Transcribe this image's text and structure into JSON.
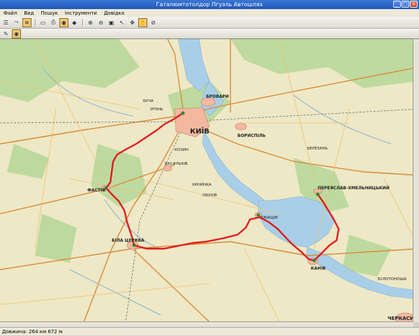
{
  "window": {
    "title": "Гаталюмтотолдор Пгуэль Автошлях"
  },
  "menu": {
    "items": [
      "Файл",
      "Вид",
      "Пошук",
      "Інструменти",
      "Довідка"
    ]
  },
  "map": {
    "cities": {
      "kyiv": "КИЇВ",
      "brovary": "БРОВАРИ",
      "boryspil": "БОРИСПІЛЬ",
      "fastiv": "ФАСТІВ",
      "bila_tserkva": "БІЛА ЦЕРКВА",
      "pereiaslav": "ПЕРЕЯСЛАВ-ХМЕЛЬНИЦЬКИЙ",
      "kaniv": "КАНІВ",
      "cherkasy": "ЧЕРКАСИ",
      "vasylkiv": "ВАСИЛЬКІВ",
      "ukrainka": "УКРАЇНКА",
      "rzhyshchiv": "РЖИЩІВ",
      "bucha": "БУЧА",
      "irpin": "ІРПІНЬ",
      "berezan": "БЕРЕЗАНЬ",
      "obukhiv": "ОБУХІВ",
      "kozyn": "КОЗИН",
      "zolotonosha": "ЗОЛОТОНОША"
    }
  },
  "status": {
    "text": "Довжина: 264 км 672 м"
  },
  "colors": {
    "route": "#e21a1a",
    "water": "#a9cfe8",
    "forest": "#b8d89a",
    "land": "#eee8c6"
  }
}
